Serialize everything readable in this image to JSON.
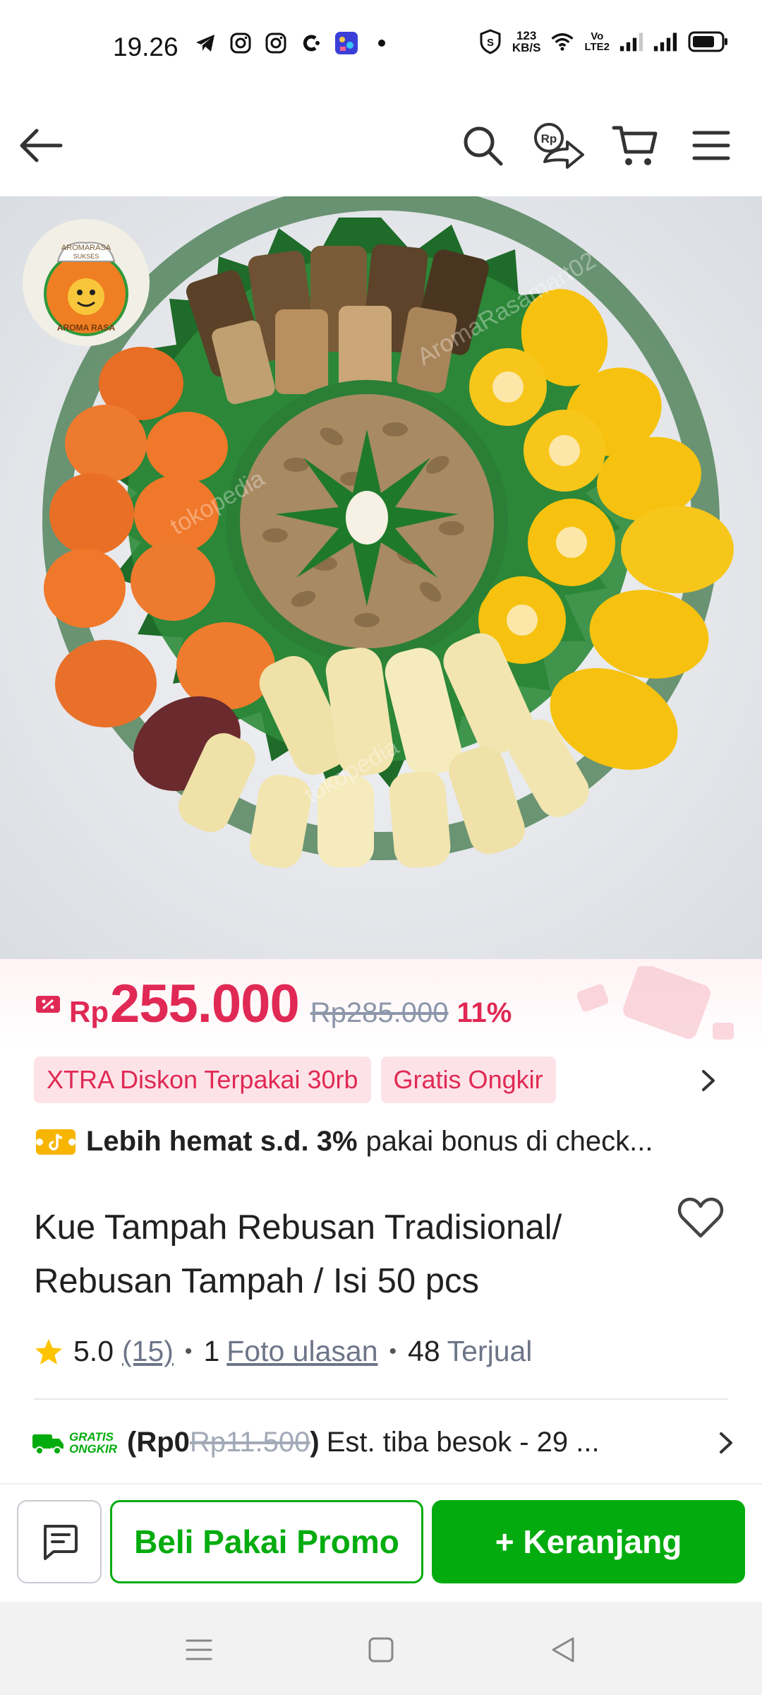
{
  "status_bar": {
    "time": "19.26",
    "net_speed_value": "123",
    "net_speed_unit": "KB/S",
    "volte_top": "Vo",
    "volte_bottom": "LTE2",
    "icons": [
      "telegram-icon",
      "instagram-icon",
      "instagram-icon",
      "c-app-icon",
      "game-app-icon",
      "dot-icon",
      "vpn-shield-icon",
      "wifi-icon",
      "signal-icon",
      "signal-icon",
      "battery-icon"
    ]
  },
  "nav": {
    "icons": [
      "back-arrow-icon",
      "search-icon",
      "share-rp-icon",
      "cart-icon",
      "menu-icon"
    ]
  },
  "product": {
    "store_logo_top": "AROMARASA",
    "store_logo_sub": "SUKSES",
    "store_logo_name": "AROMA RASA",
    "watermark": "tokopedia",
    "watermark_2": "AromaRasamart02"
  },
  "price": {
    "currency": "Rp",
    "amount": "255.000",
    "old": "Rp285.000",
    "discount": "11%"
  },
  "chips": [
    "XTRA Diskon Terpakai 30rb",
    "Gratis Ongkir"
  ],
  "hemat": {
    "bold": "Lebih hemat s.d. 3%",
    "rest": "pakai bonus di check..."
  },
  "title": "Kue Tampah Rebusan Tradisional/ Rebusan Tampah / Isi 50 pcs",
  "rating": {
    "score": "5.0",
    "count": "(15)",
    "photo_count": "1",
    "photo_label": "Foto ulasan",
    "sold": "48",
    "sold_label": "Terjual"
  },
  "shipping": {
    "badge_top": "GRATIS",
    "badge_bottom": "ONGKIR",
    "price_new": "(Rp0",
    "price_old": "Rp11.500",
    "close_paren": ")",
    "eta": "Est. tiba besok - 29 ..."
  },
  "actions": {
    "promo": "Beli Pakai Promo",
    "cart": "+ Keranjang"
  },
  "colors": {
    "accent_red": "#e02954",
    "accent_green": "#03ac0e",
    "muted": "#6d7588"
  }
}
